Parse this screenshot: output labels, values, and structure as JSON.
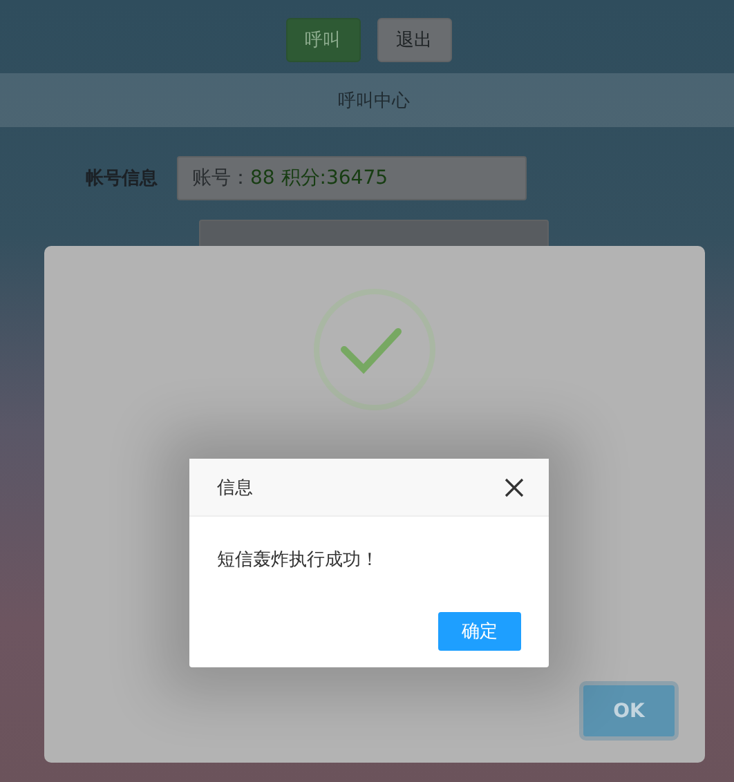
{
  "toolbar": {
    "buttons": [
      {
        "label": "呼叫",
        "kind": "primary"
      },
      {
        "label": "退出",
        "kind": "default"
      }
    ]
  },
  "header": {
    "title": "呼叫中心"
  },
  "form": {
    "rows": [
      {
        "label": "帐号信息",
        "prefix": "账号：",
        "value": "88 积分:36475"
      }
    ]
  },
  "success_modal": {
    "kind": "success",
    "button": "OK"
  },
  "dialog": {
    "title": "信息",
    "message": "短信轰炸执行成功！",
    "button": "确定"
  }
}
